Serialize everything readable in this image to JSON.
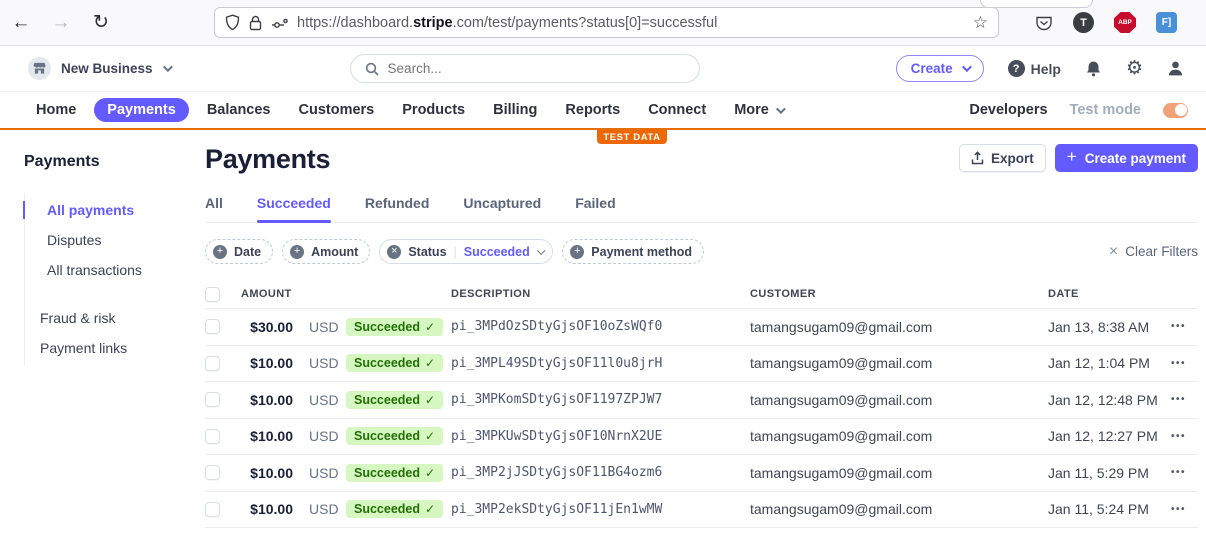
{
  "colors": {
    "accent": "#635bff",
    "test_orange": "#ed6704",
    "badge_bg": "#d7f7c2",
    "badge_text": "#217005"
  },
  "browser": {
    "url_prefix": "https://dashboard.",
    "url_domain": "stripe",
    "url_suffix": ".com/test/payments?status[0]=successful",
    "ext_t_label": "T",
    "ext_abp_label": "ABP",
    "ext_f1_label": "F]"
  },
  "topbar": {
    "business_name": "New Business",
    "search_placeholder": "Search...",
    "create_label": "Create",
    "help_label": "Help"
  },
  "nav": {
    "items": [
      "Home",
      "Payments",
      "Balances",
      "Customers",
      "Products",
      "Billing",
      "Reports",
      "Connect",
      "More"
    ],
    "active_item": "Payments",
    "developers_label": "Developers",
    "test_mode_label": "Test mode"
  },
  "banner": {
    "test_data_label": "TEST DATA"
  },
  "sidebar": {
    "heading": "Payments",
    "items": [
      {
        "label": "All payments",
        "active": true
      },
      {
        "label": "Disputes",
        "active": false
      },
      {
        "label": "All transactions",
        "active": false
      },
      {
        "label": "Fraud & risk",
        "active": false
      },
      {
        "label": "Payment links",
        "active": false
      }
    ]
  },
  "main": {
    "title": "Payments",
    "export_label": "Export",
    "create_payment_plus": "+",
    "create_payment_label": "Create payment",
    "tabs": [
      "All",
      "Succeeded",
      "Refunded",
      "Uncaptured",
      "Failed"
    ],
    "active_tab": "Succeeded",
    "filters": {
      "date_label": "Date",
      "amount_label": "Amount",
      "status_label": "Status",
      "status_value": "Succeeded",
      "payment_method_label": "Payment method",
      "clear_label": "Clear Filters",
      "clear_x": "×"
    },
    "table": {
      "columns": [
        "AMOUNT",
        "DESCRIPTION",
        "CUSTOMER",
        "DATE"
      ],
      "status_check": "✓",
      "overflow_dots": "•••",
      "rows": [
        {
          "amount": "$30.00",
          "currency": "USD",
          "status": "Succeeded",
          "description": "pi_3MPdOzSDtyGjsOF10oZsWQf0",
          "customer": "tamangsugam09@gmail.com",
          "date": "Jan 13, 8:38 AM"
        },
        {
          "amount": "$10.00",
          "currency": "USD",
          "status": "Succeeded",
          "description": "pi_3MPL49SDtyGjsOF11l0u8jrH",
          "customer": "tamangsugam09@gmail.com",
          "date": "Jan 12, 1:04 PM"
        },
        {
          "amount": "$10.00",
          "currency": "USD",
          "status": "Succeeded",
          "description": "pi_3MPKomSDtyGjsOF1197ZPJW7",
          "customer": "tamangsugam09@gmail.com",
          "date": "Jan 12, 12:48 PM"
        },
        {
          "amount": "$10.00",
          "currency": "USD",
          "status": "Succeeded",
          "description": "pi_3MPKUwSDtyGjsOF10NrnX2UE",
          "customer": "tamangsugam09@gmail.com",
          "date": "Jan 12, 12:27 PM"
        },
        {
          "amount": "$10.00",
          "currency": "USD",
          "status": "Succeeded",
          "description": "pi_3MP2jJSDtyGjsOF11BG4ozm6",
          "customer": "tamangsugam09@gmail.com",
          "date": "Jan 11, 5:29 PM"
        },
        {
          "amount": "$10.00",
          "currency": "USD",
          "status": "Succeeded",
          "description": "pi_3MP2ekSDtyGjsOF11jEn1wMW",
          "customer": "tamangsugam09@gmail.com",
          "date": "Jan 11, 5:24 PM"
        }
      ]
    }
  }
}
